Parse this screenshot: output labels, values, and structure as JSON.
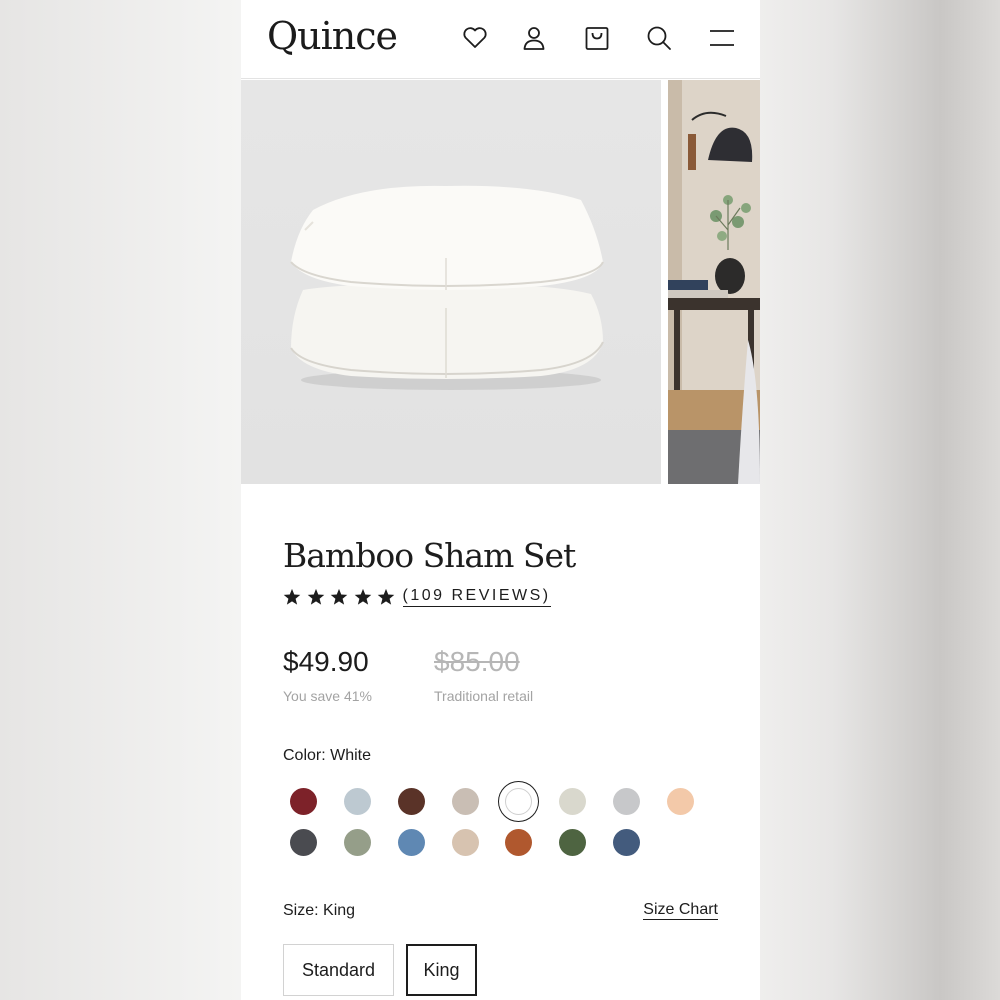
{
  "brand": "Quince",
  "header": {
    "icons": [
      "heart-icon",
      "account-icon",
      "bag-icon",
      "search-icon",
      "menu-icon"
    ]
  },
  "product": {
    "title": "Bamboo Sham Set",
    "rating": 5,
    "reviews_label": "(109 REVIEWS)",
    "price": "$49.90",
    "savings": "You save 41%",
    "retail_price": "$85.00",
    "retail_label": "Traditional retail"
  },
  "color": {
    "label": "Color: White",
    "swatches": [
      {
        "name": "red",
        "hex": "#7d2229"
      },
      {
        "name": "light-blue",
        "hex": "#bdc9d1"
      },
      {
        "name": "brown",
        "hex": "#5a3328"
      },
      {
        "name": "taupe",
        "hex": "#c9beb4"
      },
      {
        "name": "white",
        "hex": "#ffffff",
        "selected": true
      },
      {
        "name": "ivory",
        "hex": "#d9d8cd"
      },
      {
        "name": "silver",
        "hex": "#c7c8ca"
      },
      {
        "name": "peach",
        "hex": "#f3c9a9"
      },
      {
        "name": "charcoal",
        "hex": "#4a4b50"
      },
      {
        "name": "sage",
        "hex": "#959e89"
      },
      {
        "name": "blue",
        "hex": "#5f88b3"
      },
      {
        "name": "sand",
        "hex": "#d7c3b0"
      },
      {
        "name": "rust",
        "hex": "#b0582e"
      },
      {
        "name": "green",
        "hex": "#4e6441"
      },
      {
        "name": "navy",
        "hex": "#435b7d"
      }
    ]
  },
  "size": {
    "label": "Size: King",
    "chart_link": "Size Chart",
    "options": [
      {
        "label": "Standard",
        "selected": false
      },
      {
        "label": "King",
        "selected": true
      }
    ]
  }
}
